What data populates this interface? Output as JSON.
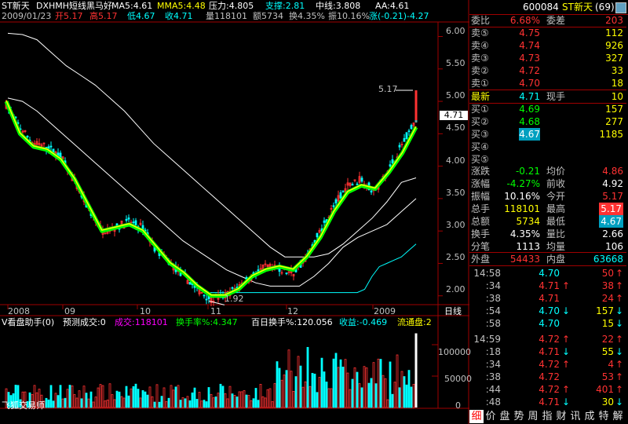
{
  "header": {
    "stock_name": "ST新天",
    "indicator_name": "DXHMH短线黑马好",
    "ma5": "MA5:4.61",
    "mma5": "MMA5:4.48",
    "pressure": "压力:4.805",
    "support": "支撑:2.81",
    "midline": "中线:3.808",
    "aa": "AA:4.61"
  },
  "ohlc_line": {
    "date": "2009/01/23",
    "open": "开5.17",
    "high": "高5.17",
    "low": "低4.67",
    "close": "收4.71",
    "volume": "量118101",
    "amount": "额5734",
    "turnover": "换4.35%",
    "amplitude": "振10.16%",
    "change": "涨(-0.21)-4.27"
  },
  "price_axis": {
    "ticks": [
      "6.00",
      "5.50",
      "5.00",
      "4.50",
      "4.00",
      "3.50",
      "3.00",
      "2.50",
      "2.00"
    ],
    "current_marker": "4.71",
    "high_label": "5.17",
    "low_label": "1.92"
  },
  "date_axis": {
    "labels": [
      "2008",
      "09",
      "10",
      "11",
      "12",
      "2009"
    ],
    "period_label": "日线"
  },
  "volume_panel": {
    "title": "V看盘助手(0)",
    "predict": "预测成交:0",
    "vol_label": "成交:118101",
    "turnover_rate": "换手率%:4.347",
    "hundred_day": "百日换手%:120.056",
    "income": "收益:-0.469",
    "float": "流通盘:2",
    "ticks": [
      "100000",
      "50000",
      "0"
    ],
    "watermark": "飞狐交易师"
  },
  "quote": {
    "code": "600084",
    "name": "ST新天",
    "count": "(69)",
    "weibi_label": "委比",
    "weibi_value": "6.68%",
    "weicha_label": "委差",
    "weicha_value": "203",
    "sell": [
      {
        "label": "卖⑤",
        "price": "4.75",
        "vol": "112"
      },
      {
        "label": "卖④",
        "price": "4.74",
        "vol": "926"
      },
      {
        "label": "卖③",
        "price": "4.73",
        "vol": "327"
      },
      {
        "label": "卖②",
        "price": "4.72",
        "vol": "33"
      },
      {
        "label": "卖①",
        "price": "4.70",
        "vol": "18"
      }
    ],
    "latest_label": "最新",
    "latest_price": "4.71",
    "now_hand_label": "现手",
    "now_hand_value": "10",
    "buy": [
      {
        "label": "买①",
        "price": "4.69",
        "vol": "157"
      },
      {
        "label": "买②",
        "price": "4.68",
        "vol": "277"
      },
      {
        "label": "买③",
        "price": "4.67",
        "vol": "1185"
      },
      {
        "label": "买④",
        "price": "",
        "vol": ""
      },
      {
        "label": "买⑤",
        "price": "",
        "vol": ""
      }
    ],
    "stats": [
      {
        "l1": "涨跌",
        "v1": "-0.21",
        "l2": "均价",
        "v2": "4.86"
      },
      {
        "l1": "涨幅",
        "v1": "-4.27%",
        "l2": "前收",
        "v2": "4.92"
      },
      {
        "l1": "振幅",
        "v1": "10.16%",
        "l2": "今开",
        "v2": "5.17"
      },
      {
        "l1": "总手",
        "v1": "118101",
        "l2": "最高",
        "v2": "5.17"
      },
      {
        "l1": "总额",
        "v1": "5734",
        "l2": "最低",
        "v2": "4.67"
      },
      {
        "l1": "换手",
        "v1": "4.35%",
        "l2": "量比",
        "v2": "2.66"
      },
      {
        "l1": "分笔",
        "v1": "1113",
        "l2": "均量",
        "v2": "106"
      }
    ],
    "outer_label": "外盘",
    "outer_value": "54433",
    "inner_label": "内盘",
    "inner_value": "63668"
  },
  "ticks": [
    {
      "t": "14:58",
      "p": "4.70",
      "a": "",
      "v": "50",
      "s": "↑"
    },
    {
      "t": ":34",
      "p": "4.71",
      "a": "↑",
      "v": "38",
      "s": "↑"
    },
    {
      "t": ":38",
      "p": "4.71",
      "a": "",
      "v": "24",
      "s": "↑"
    },
    {
      "t": ":54",
      "p": "4.70",
      "a": "↓",
      "v": "157",
      "s": "↓"
    },
    {
      "t": ":58",
      "p": "4.70",
      "a": "",
      "v": "15",
      "s": "↓"
    },
    {
      "t": "14:59",
      "p": "4.72",
      "a": "↑",
      "v": "22",
      "s": "↑"
    },
    {
      "t": ":18",
      "p": "4.71",
      "a": "↓",
      "v": "55",
      "s": "↓"
    },
    {
      "t": ":34",
      "p": "4.72",
      "a": "↑",
      "v": "4",
      "s": "↑"
    },
    {
      "t": ":38",
      "p": "4.72",
      "a": "",
      "v": "53",
      "s": "↑"
    },
    {
      "t": ":44",
      "p": "4.72",
      "a": "↑",
      "v": "401",
      "s": "↑"
    },
    {
      "t": ":48",
      "p": "4.71",
      "a": "↓",
      "v": "30",
      "s": "↓"
    },
    {
      "t": ":54",
      "p": "4.71",
      "a": "",
      "v": "2",
      "s": "↓"
    }
  ],
  "tabs": [
    "细",
    "价",
    "盘",
    "势",
    "周",
    "指",
    "财",
    "讯",
    "成",
    "特",
    "解"
  ],
  "colors": {
    "up": "#ff3232",
    "down": "#00ffff",
    "ma_green": "#00ff00",
    "ma_yellow": "#ffff00",
    "grid": "#800000",
    "axis": "#a00000",
    "white": "#ffffff",
    "label": "#c0c0c0"
  },
  "chart_data": {
    "type": "candlestick",
    "y_range": [
      1.9,
      6.2
    ],
    "volume_range": [
      0,
      130000
    ],
    "last_bar": {
      "open": 5.17,
      "high": 5.17,
      "low": 4.67,
      "close": 4.71,
      "volume": 118101
    },
    "pressure_line": [
      6.05,
      6.03,
      5.95,
      5.75,
      5.55,
      5.4,
      5.25,
      5.05,
      4.85,
      4.6,
      4.35,
      4.15,
      3.95,
      3.75,
      3.55,
      3.35,
      3.15,
      2.95,
      2.75,
      2.6,
      2.6,
      2.6,
      2.65,
      2.8,
      3.0,
      3.2,
      3.45,
      3.75,
      3.82
    ],
    "midline": [
      5.05,
      5.0,
      4.85,
      4.65,
      4.45,
      4.25,
      4.05,
      3.85,
      3.65,
      3.45,
      3.25,
      3.05,
      2.85,
      2.7,
      2.55,
      2.4,
      2.3,
      2.2,
      2.15,
      2.15,
      2.15,
      2.3,
      2.5,
      2.75,
      2.9,
      3.0,
      3.1,
      3.3,
      3.5
    ],
    "support_line": [
      2.05,
      2.05,
      2.05,
      2.05,
      2.05,
      2.05,
      2.05,
      2.05,
      2.05,
      2.05,
      2.05,
      2.05,
      2.05,
      2.05,
      2.05,
      2.05,
      2.05,
      2.05,
      2.05,
      2.05,
      2.05,
      2.1,
      2.3,
      2.45,
      2.5,
      2.55,
      2.6,
      2.7,
      2.8
    ],
    "ma_line": [
      5.0,
      4.5,
      4.3,
      4.25,
      4.1,
      3.8,
      3.4,
      3.0,
      3.05,
      3.1,
      3.0,
      2.75,
      2.5,
      2.35,
      2.15,
      2.0,
      2.0,
      2.1,
      2.3,
      2.4,
      2.45,
      2.4,
      2.6,
      2.9,
      3.3,
      3.6,
      3.7,
      3.65,
      3.9,
      4.2,
      4.6
    ],
    "price_path": [
      4.95,
      4.6,
      4.35,
      4.3,
      4.15,
      3.75,
      3.35,
      3.0,
      3.05,
      3.15,
      3.05,
      2.7,
      2.5,
      2.3,
      2.1,
      1.95,
      2.0,
      2.15,
      2.3,
      2.45,
      2.4,
      2.35,
      2.6,
      3.0,
      3.4,
      3.7,
      3.8,
      3.6,
      3.95,
      4.35,
      4.71
    ]
  }
}
